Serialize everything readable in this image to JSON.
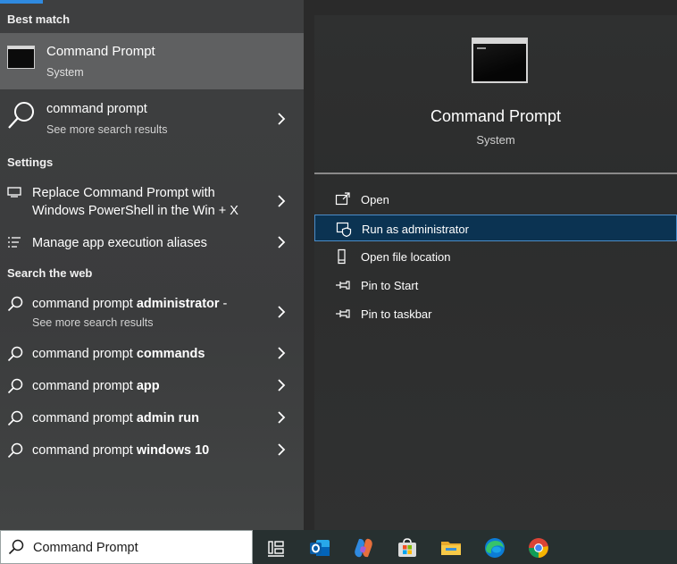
{
  "left_panel": {
    "best_match_heading": "Best match",
    "best_match": {
      "title": "Command Prompt",
      "subtitle": "System"
    },
    "search_result": {
      "title": "command prompt",
      "subtitle": "See more search results"
    },
    "settings_heading": "Settings",
    "settings_items": [
      {
        "line1": "Replace Command Prompt with",
        "line2": "Windows PowerShell in the Win + X"
      },
      {
        "line1": "Manage app execution aliases"
      }
    ],
    "web_heading": "Search the web",
    "web_items": [
      {
        "prefix": "command prompt ",
        "bold": "administrator",
        "suffix": " -",
        "subtitle": "See more search results"
      },
      {
        "prefix": "command prompt ",
        "bold": "commands"
      },
      {
        "prefix": "command prompt ",
        "bold": "app"
      },
      {
        "prefix": "command prompt ",
        "bold": "admin run"
      },
      {
        "prefix": "command prompt ",
        "bold": "windows 10"
      }
    ]
  },
  "right_panel": {
    "app_title": "Command Prompt",
    "app_subtitle": "System",
    "actions": [
      {
        "label": "Open",
        "icon": "open-icon"
      },
      {
        "label": "Run as administrator",
        "icon": "shield-icon"
      },
      {
        "label": "Open file location",
        "icon": "file-location-icon"
      },
      {
        "label": "Pin to Start",
        "icon": "pin-icon"
      },
      {
        "label": "Pin to taskbar",
        "icon": "pin-icon"
      }
    ],
    "selected_action": "Run as administrator"
  },
  "taskbar": {
    "search_value": "Command Prompt",
    "apps": [
      "task-view-icon",
      "outlook-icon",
      "copilot-icon",
      "store-icon",
      "file-explorer-icon",
      "edge-icon",
      "chrome-icon"
    ]
  },
  "colors": {
    "accent": "#2f8ae0",
    "selection_bg": "#0b3352",
    "selection_border": "#4c8dc8",
    "best_match_bg": "#5f6061"
  }
}
